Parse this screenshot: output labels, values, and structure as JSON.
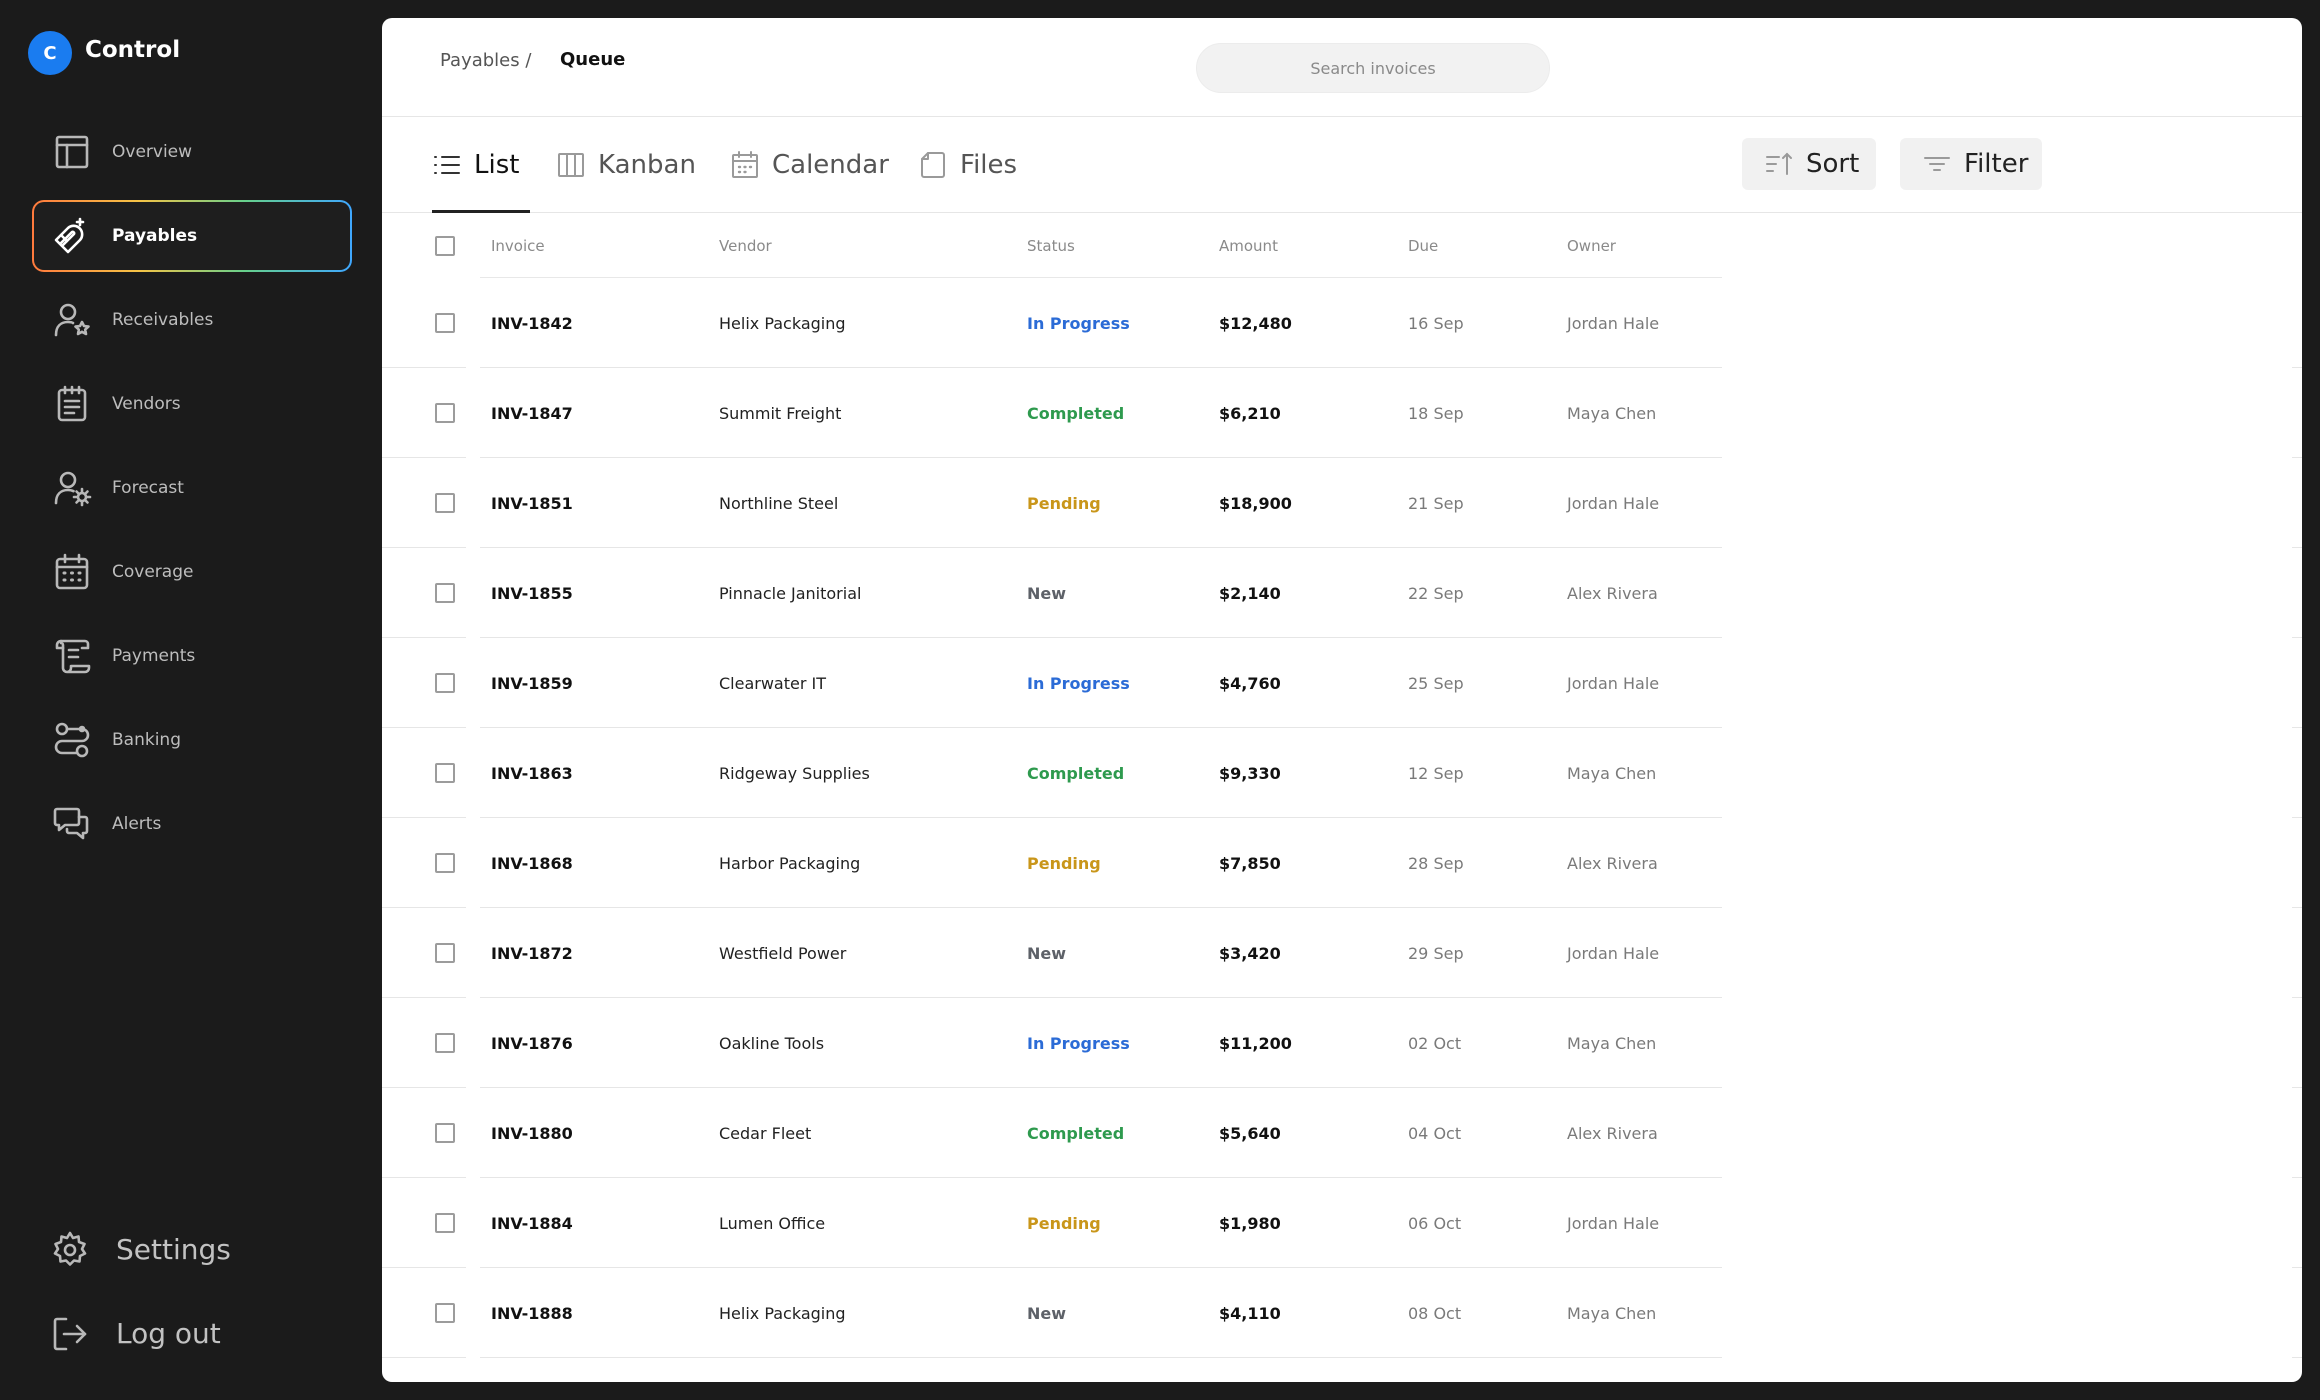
{
  "brand": {
    "logo_letter": "C",
    "name": "Control",
    "logo_color": "#1a7cf0"
  },
  "sidebar": {
    "items": [
      {
        "label": "Overview",
        "icon": "layout-icon"
      },
      {
        "label": "Payables",
        "icon": "magnet-icon",
        "active": true
      },
      {
        "label": "Receivables",
        "icon": "user-star-icon"
      },
      {
        "label": "Vendors",
        "icon": "notepad-icon"
      },
      {
        "label": "Forecast",
        "icon": "user-gear-icon"
      },
      {
        "label": "Coverage",
        "icon": "calendar-grid-icon"
      },
      {
        "label": "Payments",
        "icon": "scroll-icon"
      },
      {
        "label": "Banking",
        "icon": "route-icon"
      },
      {
        "label": "Alerts",
        "icon": "chat-icon"
      }
    ],
    "bottom": [
      {
        "label": "Settings",
        "icon": "gear-icon"
      },
      {
        "label": "Log out",
        "icon": "logout-icon"
      }
    ]
  },
  "header": {
    "breadcrumb_parent": "Payables /",
    "breadcrumb_current": "Queue",
    "search_placeholder": "Search invoices"
  },
  "tabs": [
    {
      "label": "List",
      "icon": "list-icon",
      "active": true
    },
    {
      "label": "Kanban",
      "icon": "kanban-icon"
    },
    {
      "label": "Calendar",
      "icon": "calendar-icon"
    },
    {
      "label": "Files",
      "icon": "file-icon"
    }
  ],
  "toolbar": {
    "sort_label": "Sort",
    "filter_label": "Filter"
  },
  "table": {
    "columns": [
      "Invoice",
      "Vendor",
      "Status",
      "Amount",
      "Due",
      "Owner"
    ],
    "rows": [
      {
        "invoice": "INV-1842",
        "vendor": "Helix Packaging",
        "status": "In Progress",
        "amount": "$12,480",
        "due": "16 Sep",
        "owner": "Jordan Hale"
      },
      {
        "invoice": "INV-1847",
        "vendor": "Summit Freight",
        "status": "Completed",
        "amount": "$6,210",
        "due": "18 Sep",
        "owner": "Maya Chen"
      },
      {
        "invoice": "INV-1851",
        "vendor": "Northline Steel",
        "status": "Pending",
        "amount": "$18,900",
        "due": "21 Sep",
        "owner": "Jordan Hale"
      },
      {
        "invoice": "INV-1855",
        "vendor": "Pinnacle Janitorial",
        "status": "New",
        "amount": "$2,140",
        "due": "22 Sep",
        "owner": "Alex Rivera"
      },
      {
        "invoice": "INV-1859",
        "vendor": "Clearwater IT",
        "status": "In Progress",
        "amount": "$4,760",
        "due": "25 Sep",
        "owner": "Jordan Hale"
      },
      {
        "invoice": "INV-1863",
        "vendor": "Ridgeway Supplies",
        "status": "Completed",
        "amount": "$9,330",
        "due": "12 Sep",
        "owner": "Maya Chen"
      },
      {
        "invoice": "INV-1868",
        "vendor": "Harbor Packaging",
        "status": "Pending",
        "amount": "$7,850",
        "due": "28 Sep",
        "owner": "Alex Rivera"
      },
      {
        "invoice": "INV-1872",
        "vendor": "Westfield Power",
        "status": "New",
        "amount": "$3,420",
        "due": "29 Sep",
        "owner": "Jordan Hale"
      },
      {
        "invoice": "INV-1876",
        "vendor": "Oakline Tools",
        "status": "In Progress",
        "amount": "$11,200",
        "due": "02 Oct",
        "owner": "Maya Chen"
      },
      {
        "invoice": "INV-1880",
        "vendor": "Cedar Fleet",
        "status": "Completed",
        "amount": "$5,640",
        "due": "04 Oct",
        "owner": "Alex Rivera"
      },
      {
        "invoice": "INV-1884",
        "vendor": "Lumen Office",
        "status": "Pending",
        "amount": "$1,980",
        "due": "06 Oct",
        "owner": "Jordan Hale"
      },
      {
        "invoice": "INV-1888",
        "vendor": "Helix Packaging",
        "status": "New",
        "amount": "$4,110",
        "due": "08 Oct",
        "owner": "Maya Chen"
      }
    ]
  },
  "status_colors": {
    "In Progress": "#2b6bd6",
    "Completed": "#2e9a4e",
    "Pending": "#c9961a",
    "New": "#5d6168"
  }
}
